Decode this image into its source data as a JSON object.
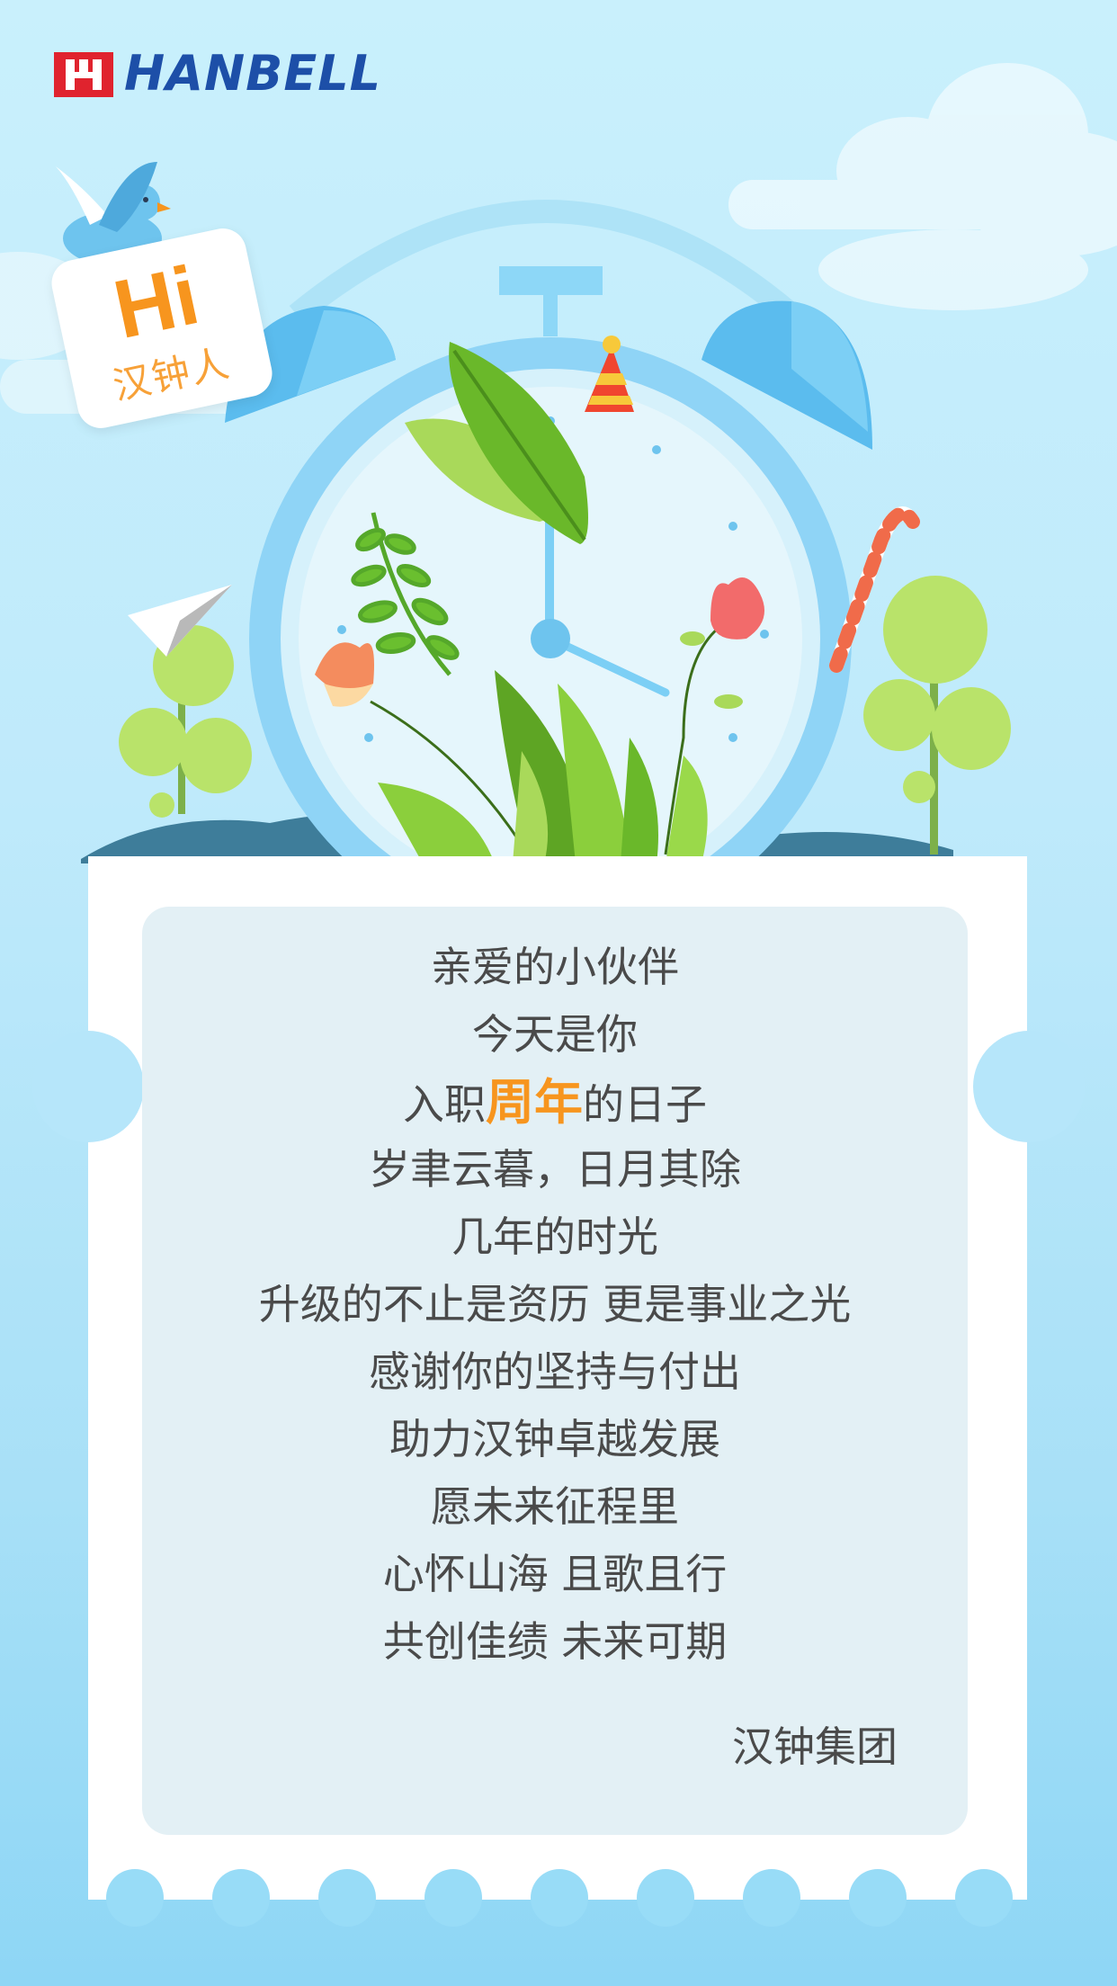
{
  "header": {
    "logo_text": "HANBELL",
    "logo_icon": "hanbell-logo-icon"
  },
  "badge": {
    "title": "Hi",
    "subtitle": "汉钟人"
  },
  "poem": {
    "line1": "亲爱的小伙伴",
    "line2": "今天是你",
    "line3_pre": "入职",
    "line3_hl": "周年",
    "line3_post": "的日子",
    "line4": "岁聿云暮，日月其除",
    "line5": "几年的时光",
    "line6": "升级的不止是资历 更是事业之光",
    "line7": "感谢你的坚持与付出",
    "line8": "助力汉钟卓越发展",
    "line9": "愿未来征程里",
    "line10": "心怀山海 且歌且行",
    "line11": "共创佳绩 未来可期"
  },
  "signature": "汉钟集团",
  "colors": {
    "accent": "#f7951e",
    "brand_blue": "#1d4fa8",
    "brand_red": "#e0232e",
    "text": "#4a4a4a"
  }
}
